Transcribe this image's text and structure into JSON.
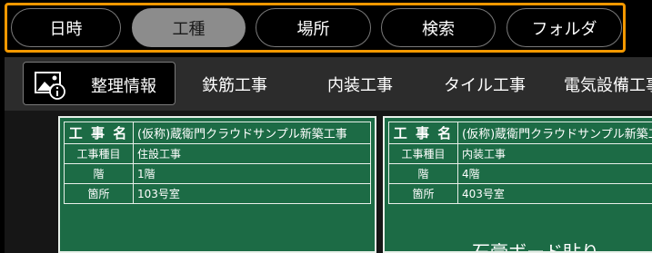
{
  "filters": [
    "日時",
    "工種",
    "場所",
    "検索",
    "フォルダ"
  ],
  "categories": [
    "整理情報",
    "鉄筋工事",
    "内装工事",
    "タイル工事",
    "電気設備工事"
  ],
  "boards": [
    {
      "rows": [
        {
          "key": "工 事 名",
          "val": "(仮称)蔵衛門クラウドサンプル新築工事"
        },
        {
          "key": "工事種目",
          "val": "住設工事"
        },
        {
          "key": "階",
          "val": "1階"
        },
        {
          "key": "箇所",
          "val": "103号室"
        }
      ],
      "note": ""
    },
    {
      "rows": [
        {
          "key": "工 事 名",
          "val": "(仮称)蔵衛門クラウドサンプル新築工事"
        },
        {
          "key": "工事種目",
          "val": "内装工事"
        },
        {
          "key": "階",
          "val": "4階"
        },
        {
          "key": "箇所",
          "val": "403号室"
        }
      ],
      "note": "石膏ボード貼り"
    }
  ]
}
